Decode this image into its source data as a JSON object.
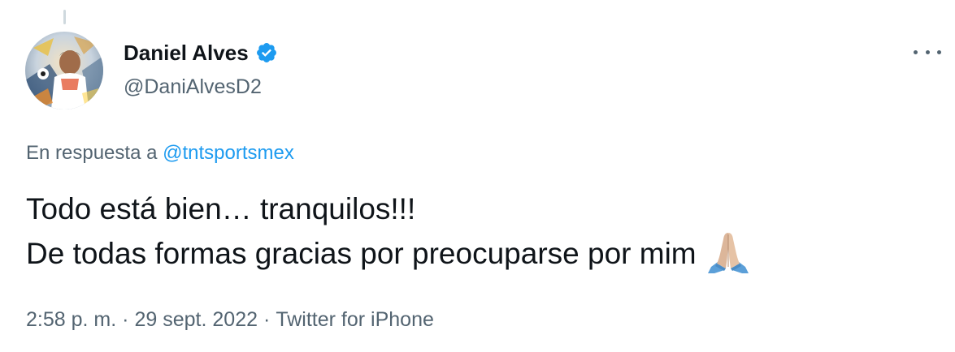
{
  "tweet": {
    "author": {
      "display_name": "Daniel Alves",
      "handle": "@DaniAlvesD2",
      "verified": true,
      "avatar_icon": "profile-photo"
    },
    "reply": {
      "prefix": "En respuesta a",
      "mention": "@tntsportsmex"
    },
    "text_lines": [
      "Todo está bien… tranquilos!!!",
      "De todas formas gracias por preocuparse por mim"
    ],
    "emoji": "folded-hands-icon",
    "meta": {
      "time": "2:58 p. m.",
      "separator": "·",
      "date": "29 sept. 2022",
      "source": "Twitter for iPhone"
    },
    "more_icon": "more-horizontal-icon"
  },
  "colors": {
    "text_primary": "#0f1419",
    "text_secondary": "#536471",
    "link": "#1d9bf0",
    "verified": "#1d9bf0",
    "thread_line": "#cfd9de"
  }
}
